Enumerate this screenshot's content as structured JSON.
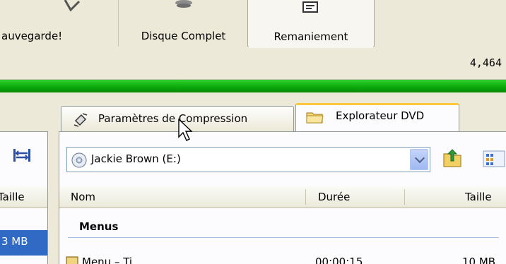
{
  "toolbar": {
    "backup_label": "auvegarde!",
    "full_disc_label": "Disque Complet",
    "remaster_label": "Remaniement"
  },
  "status": {
    "size_readout": "4,464"
  },
  "tabs": {
    "compression_label": "Paramètres de Compression",
    "explorer_label": "Explorateur DVD"
  },
  "explorer": {
    "drive_selector_value": "Jackie Brown (E:)",
    "columns": [
      "Nom",
      "Durée",
      "Taille"
    ],
    "group_label": "Menus",
    "partial_row": {
      "name": "Menu – Ti…",
      "duration": "00:00:15",
      "size": "10 MB"
    }
  },
  "left_pane": {
    "column_label": "Taille",
    "selected_value": "3 MB"
  },
  "colors": {
    "progress": "#0aa80a",
    "selection": "#316ac5",
    "active_tab_accent": "#ffc83c"
  }
}
